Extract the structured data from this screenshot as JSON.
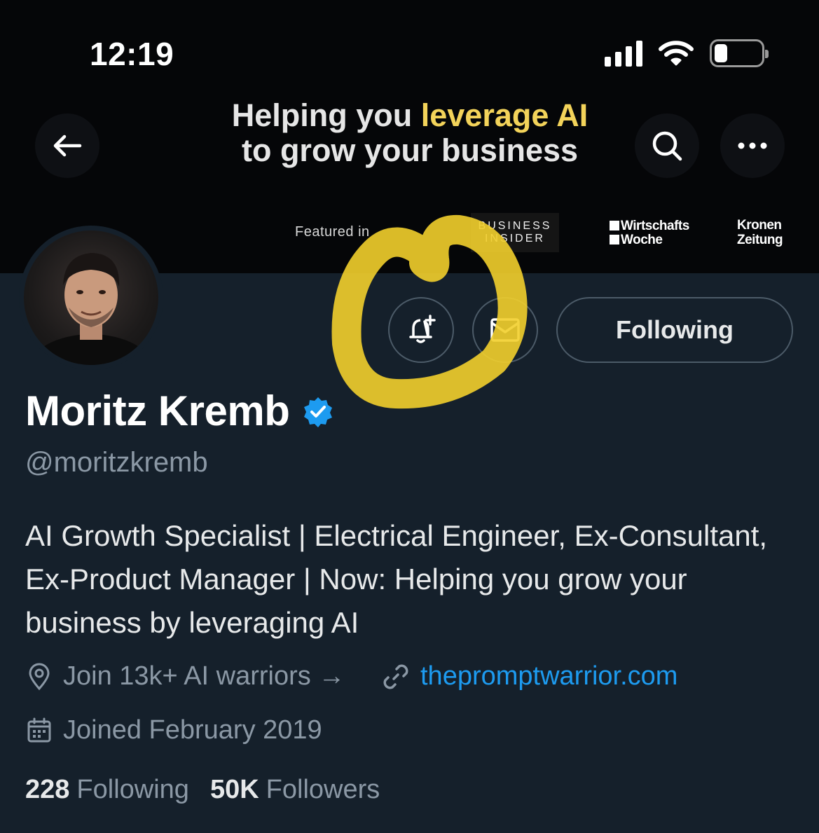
{
  "status_bar": {
    "time": "12:19"
  },
  "banner": {
    "tagline_prefix": "Helping you ",
    "tagline_accent": "leverage AI",
    "tagline_line2": "to grow your business",
    "featured_label": "Featured in",
    "logos": {
      "business_insider_line1": "BUSINESS",
      "business_insider_line2": "INSIDER",
      "wirtschaftswoche_line1": "Wirtschafts",
      "wirtschaftswoche_line2": "Woche",
      "kronen_zeitung_line1": "Kronen",
      "kronen_zeitung_line2": "Zeitung"
    }
  },
  "profile": {
    "name": "Moritz Kremb",
    "handle": "@moritzkremb",
    "verified": true,
    "bio": "AI Growth Specialist | Electrical Engineer, Ex-Consultant, Ex-Product Manager | Now: Helping you grow your business by leveraging AI",
    "location": "Join 13k+ AI warriors →",
    "website": "thepromptwarrior.com",
    "joined": "Joined February 2019",
    "following_count": "228",
    "following_label": "Following",
    "followers_count": "50K",
    "followers_label": "Followers"
  },
  "actions": {
    "following_button": "Following"
  },
  "colors": {
    "background": "#15202b",
    "accent_link": "#1d9bf0",
    "verified_badge": "#1d9bf0",
    "highlight": "#f2cf2c",
    "tagline_accent": "#f3d35a"
  }
}
